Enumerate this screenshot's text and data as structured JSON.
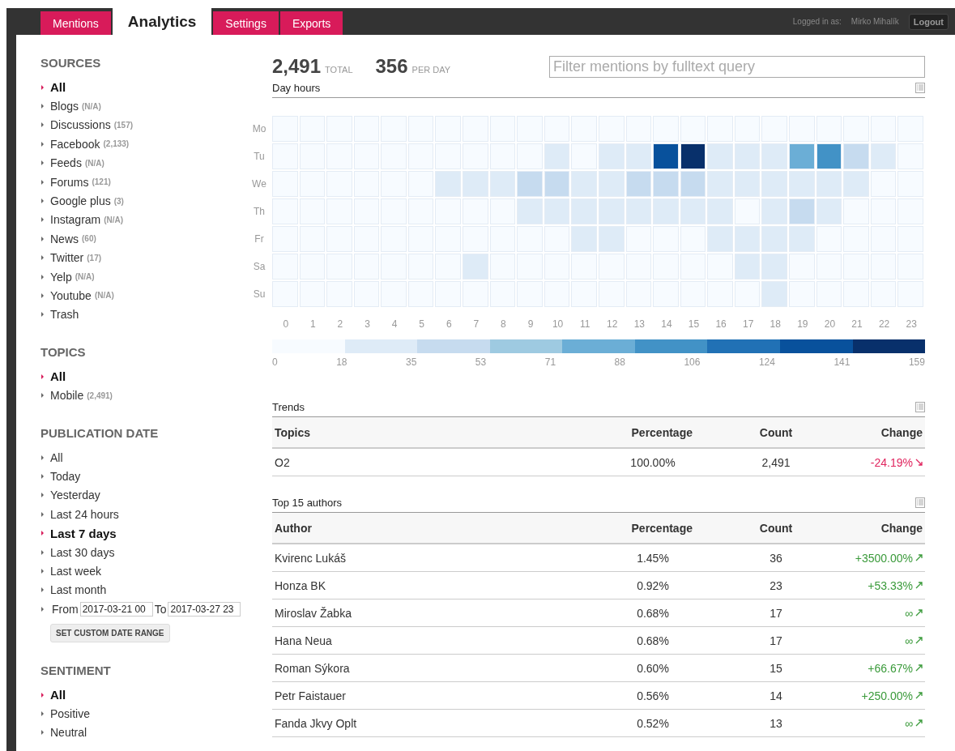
{
  "nav": {
    "tabs": [
      {
        "label": "Mentions",
        "selected": false
      },
      {
        "label": "Analytics",
        "selected": true
      },
      {
        "label": "Settings",
        "selected": false
      },
      {
        "label": "Exports",
        "selected": false
      }
    ],
    "user_label": "Logged in as:",
    "user_name": "Mirko Mihalík",
    "logout": "Logout"
  },
  "sidebar": {
    "sections": [
      {
        "title": "SOURCES",
        "items": [
          {
            "label": "All",
            "selected": true
          },
          {
            "label": "Blogs",
            "count": "(N/A)",
            "selected": false
          },
          {
            "label": "Discussions",
            "count": "(157)",
            "selected": false
          },
          {
            "label": "Facebook",
            "count": "(2,133)",
            "selected": false
          },
          {
            "label": "Feeds",
            "count": "(N/A)",
            "selected": false
          },
          {
            "label": "Forums",
            "count": "(121)",
            "selected": false
          },
          {
            "label": "Google plus",
            "count": "(3)",
            "selected": false
          },
          {
            "label": "Instagram",
            "count": "(N/A)",
            "selected": false
          },
          {
            "label": "News",
            "count": "(60)",
            "selected": false
          },
          {
            "label": "Twitter",
            "count": "(17)",
            "selected": false
          },
          {
            "label": "Yelp",
            "count": "(N/A)",
            "selected": false
          },
          {
            "label": "Youtube",
            "count": "(N/A)",
            "selected": false
          },
          {
            "label": "Trash",
            "selected": false
          }
        ]
      },
      {
        "title": "TOPICS",
        "items": [
          {
            "label": "All",
            "selected": true
          },
          {
            "label": "Mobile",
            "count": "(2,491)",
            "selected": false
          }
        ]
      },
      {
        "title": "PUBLICATION DATE",
        "items": [
          {
            "label": "All",
            "selected": false
          },
          {
            "label": "Today",
            "selected": false
          },
          {
            "label": "Yesterday",
            "selected": false
          },
          {
            "label": "Last 24 hours",
            "selected": false
          },
          {
            "label": "Last 7 days",
            "selected": true
          },
          {
            "label": "Last 30 days",
            "selected": false
          },
          {
            "label": "Last week",
            "selected": false
          },
          {
            "label": "Last month",
            "selected": false
          }
        ],
        "range": {
          "from_label": "From",
          "from_value": "2017-03-21 00",
          "to_label": "To",
          "to_value": "2017-03-27 23",
          "button": "SET CUSTOM DATE RANGE"
        }
      },
      {
        "title": "SENTIMENT",
        "items": [
          {
            "label": "All",
            "selected": true
          },
          {
            "label": "Positive",
            "selected": false
          },
          {
            "label": "Neutral",
            "selected": false
          }
        ]
      }
    ]
  },
  "stats": [
    {
      "value": "2,491",
      "unit": "TOTAL"
    },
    {
      "value": "356",
      "unit": "PER DAY"
    }
  ],
  "search": {
    "placeholder": "Filter mentions by fulltext query"
  },
  "heatmap": {
    "title": "Day hours",
    "hours": [
      "0",
      "1",
      "2",
      "3",
      "4",
      "5",
      "6",
      "7",
      "8",
      "9",
      "10",
      "11",
      "12",
      "13",
      "14",
      "15",
      "16",
      "17",
      "18",
      "19",
      "20",
      "21",
      "22",
      "23"
    ],
    "rows": [
      {
        "day": "Mo",
        "cells": [
          {
            "color": "#f7fbff"
          },
          {
            "color": "#f7fbff"
          },
          {
            "color": "#f7fbff"
          },
          {
            "color": "#f7fbff"
          },
          {
            "color": "#f7fbff"
          },
          {
            "color": "#f7fbff"
          },
          {
            "color": "#f7fbff"
          },
          {
            "color": "#f7fbff"
          },
          {
            "color": "#f7fbff"
          },
          {
            "color": "#f7fbff"
          },
          {
            "color": "#f7fbff"
          },
          {
            "color": "#f7fbff"
          },
          {
            "color": "#f7fbff"
          },
          {
            "color": "#f7fbff"
          },
          {
            "color": "#f7fbff"
          },
          {
            "color": "#f7fbff"
          },
          {
            "color": "#f7fbff"
          },
          {
            "color": "#f7fbff"
          },
          {
            "color": "#f7fbff"
          },
          {
            "color": "#f7fbff"
          },
          {
            "color": "#f7fbff"
          },
          {
            "color": "#f7fbff"
          },
          {
            "color": "#f7fbff"
          },
          {
            "color": "#f7fbff"
          }
        ]
      },
      {
        "day": "Tu",
        "cells": [
          {
            "color": "#f7fbff"
          },
          {
            "color": "#f7fbff"
          },
          {
            "color": "#f7fbff"
          },
          {
            "color": "#f7fbff"
          },
          {
            "color": "#f7fbff"
          },
          {
            "color": "#f7fbff"
          },
          {
            "color": "#f7fbff"
          },
          {
            "color": "#f7fbff"
          },
          {
            "color": "#f7fbff"
          },
          {
            "color": "#f7fbff"
          },
          {
            "color": "#deebf7"
          },
          {
            "color": "#f7fbff"
          },
          {
            "color": "#deebf7"
          },
          {
            "color": "#deebf7"
          },
          {
            "color": "#08519c"
          },
          {
            "color": "#08306b"
          },
          {
            "color": "#deebf7"
          },
          {
            "color": "#deebf7"
          },
          {
            "color": "#deebf7"
          },
          {
            "color": "#6baed6"
          },
          {
            "color": "#4292c6"
          },
          {
            "color": "#c6dbef"
          },
          {
            "color": "#deebf7"
          },
          {
            "color": "#f7fbff"
          }
        ]
      },
      {
        "day": "We",
        "cells": [
          {
            "color": "#f7fbff"
          },
          {
            "color": "#f7fbff"
          },
          {
            "color": "#f7fbff"
          },
          {
            "color": "#f7fbff"
          },
          {
            "color": "#f7fbff"
          },
          {
            "color": "#f7fbff"
          },
          {
            "color": "#deebf7"
          },
          {
            "color": "#deebf7"
          },
          {
            "color": "#deebf7"
          },
          {
            "color": "#c6dbef"
          },
          {
            "color": "#c6dbef"
          },
          {
            "color": "#deebf7"
          },
          {
            "color": "#deebf7"
          },
          {
            "color": "#c6dbef"
          },
          {
            "color": "#c6dbef"
          },
          {
            "color": "#c6dbef"
          },
          {
            "color": "#deebf7"
          },
          {
            "color": "#deebf7"
          },
          {
            "color": "#deebf7"
          },
          {
            "color": "#deebf7"
          },
          {
            "color": "#deebf7"
          },
          {
            "color": "#deebf7"
          },
          {
            "color": "#f7fbff"
          },
          {
            "color": "#f7fbff"
          }
        ]
      },
      {
        "day": "Th",
        "cells": [
          {
            "color": "#f7fbff"
          },
          {
            "color": "#f7fbff"
          },
          {
            "color": "#f7fbff"
          },
          {
            "color": "#f7fbff"
          },
          {
            "color": "#f7fbff"
          },
          {
            "color": "#f7fbff"
          },
          {
            "color": "#f7fbff"
          },
          {
            "color": "#f7fbff"
          },
          {
            "color": "#f7fbff"
          },
          {
            "color": "#deebf7"
          },
          {
            "color": "#deebf7"
          },
          {
            "color": "#deebf7"
          },
          {
            "color": "#deebf7"
          },
          {
            "color": "#deebf7"
          },
          {
            "color": "#deebf7"
          },
          {
            "color": "#deebf7"
          },
          {
            "color": "#deebf7"
          },
          {
            "color": "#f7fbff"
          },
          {
            "color": "#deebf7"
          },
          {
            "color": "#c6dbef"
          },
          {
            "color": "#deebf7"
          },
          {
            "color": "#f7fbff"
          },
          {
            "color": "#f7fbff"
          },
          {
            "color": "#f7fbff"
          }
        ]
      },
      {
        "day": "Fr",
        "cells": [
          {
            "color": "#f7fbff"
          },
          {
            "color": "#f7fbff"
          },
          {
            "color": "#f7fbff"
          },
          {
            "color": "#f7fbff"
          },
          {
            "color": "#f7fbff"
          },
          {
            "color": "#f7fbff"
          },
          {
            "color": "#f7fbff"
          },
          {
            "color": "#f7fbff"
          },
          {
            "color": "#f7fbff"
          },
          {
            "color": "#f7fbff"
          },
          {
            "color": "#f7fbff"
          },
          {
            "color": "#deebf7"
          },
          {
            "color": "#deebf7"
          },
          {
            "color": "#f7fbff"
          },
          {
            "color": "#f7fbff"
          },
          {
            "color": "#f7fbff"
          },
          {
            "color": "#deebf7"
          },
          {
            "color": "#deebf7"
          },
          {
            "color": "#deebf7"
          },
          {
            "color": "#deebf7"
          },
          {
            "color": "#f7fbff"
          },
          {
            "color": "#f7fbff"
          },
          {
            "color": "#f7fbff"
          },
          {
            "color": "#f7fbff"
          }
        ]
      },
      {
        "day": "Sa",
        "cells": [
          {
            "color": "#f7fbff"
          },
          {
            "color": "#f7fbff"
          },
          {
            "color": "#f7fbff"
          },
          {
            "color": "#f7fbff"
          },
          {
            "color": "#f7fbff"
          },
          {
            "color": "#f7fbff"
          },
          {
            "color": "#f7fbff"
          },
          {
            "color": "#deebf7"
          },
          {
            "color": "#f7fbff"
          },
          {
            "color": "#f7fbff"
          },
          {
            "color": "#f7fbff"
          },
          {
            "color": "#f7fbff"
          },
          {
            "color": "#f7fbff"
          },
          {
            "color": "#f7fbff"
          },
          {
            "color": "#f7fbff"
          },
          {
            "color": "#f7fbff"
          },
          {
            "color": "#f7fbff"
          },
          {
            "color": "#deebf7"
          },
          {
            "color": "#deebf7"
          },
          {
            "color": "#f7fbff"
          },
          {
            "color": "#f7fbff"
          },
          {
            "color": "#f7fbff"
          },
          {
            "color": "#f7fbff"
          },
          {
            "color": "#f7fbff"
          }
        ]
      },
      {
        "day": "Su",
        "cells": [
          {
            "color": "#f7fbff"
          },
          {
            "color": "#f7fbff"
          },
          {
            "color": "#f7fbff"
          },
          {
            "color": "#f7fbff"
          },
          {
            "color": "#f7fbff"
          },
          {
            "color": "#f7fbff"
          },
          {
            "color": "#f7fbff"
          },
          {
            "color": "#f7fbff"
          },
          {
            "color": "#f7fbff"
          },
          {
            "color": "#f7fbff"
          },
          {
            "color": "#f7fbff"
          },
          {
            "color": "#f7fbff"
          },
          {
            "color": "#f7fbff"
          },
          {
            "color": "#f7fbff"
          },
          {
            "color": "#f7fbff"
          },
          {
            "color": "#f7fbff"
          },
          {
            "color": "#f7fbff"
          },
          {
            "color": "#f7fbff"
          },
          {
            "color": "#deebf7"
          },
          {
            "color": "#f7fbff"
          },
          {
            "color": "#f7fbff"
          },
          {
            "color": "#f7fbff"
          },
          {
            "color": "#f7fbff"
          },
          {
            "color": "#f7fbff"
          }
        ]
      }
    ],
    "legend": {
      "swatches": [
        {
          "color": "#f7fbff"
        },
        {
          "color": "#deebf7"
        },
        {
          "color": "#c6dbef"
        },
        {
          "color": "#9ecae1"
        },
        {
          "color": "#6baed6"
        },
        {
          "color": "#4292c6"
        },
        {
          "color": "#2171b5"
        },
        {
          "color": "#08519c"
        },
        {
          "color": "#08306b"
        }
      ],
      "labels": [
        "0",
        "18",
        "35",
        "53",
        "71",
        "88",
        "106",
        "124",
        "141",
        "159"
      ]
    }
  },
  "tables": [
    {
      "title": "Trends",
      "columns": [
        "Topics",
        "Percentage",
        "Count",
        "Change"
      ],
      "rows": [
        {
          "name": "O2",
          "percentage": "100.00%",
          "count": "2,491",
          "change": "-24.19%",
          "kind": "down"
        }
      ]
    },
    {
      "title": "Top 15 authors",
      "columns": [
        "Author",
        "Percentage",
        "Count",
        "Change"
      ],
      "rows": [
        {
          "name": "Kvirenc Lukáš",
          "percentage": "1.45%",
          "count": "36",
          "change": "+3500.00%",
          "kind": "up"
        },
        {
          "name": "Honza BK",
          "percentage": "0.92%",
          "count": "23",
          "change": "+53.33%",
          "kind": "up"
        },
        {
          "name": "Miroslav Žabka",
          "percentage": "0.68%",
          "count": "17",
          "change": "∞",
          "kind": "up"
        },
        {
          "name": "Hana Neua",
          "percentage": "0.68%",
          "count": "17",
          "change": "∞",
          "kind": "up"
        },
        {
          "name": "Roman Sýkora",
          "percentage": "0.60%",
          "count": "15",
          "change": "+66.67%",
          "kind": "up"
        },
        {
          "name": "Petr Faistauer",
          "percentage": "0.56%",
          "count": "14",
          "change": "+250.00%",
          "kind": "up"
        },
        {
          "name": "Fanda Jkvy Oplt",
          "percentage": "0.52%",
          "count": "13",
          "change": "∞",
          "kind": "up"
        }
      ]
    }
  ]
}
